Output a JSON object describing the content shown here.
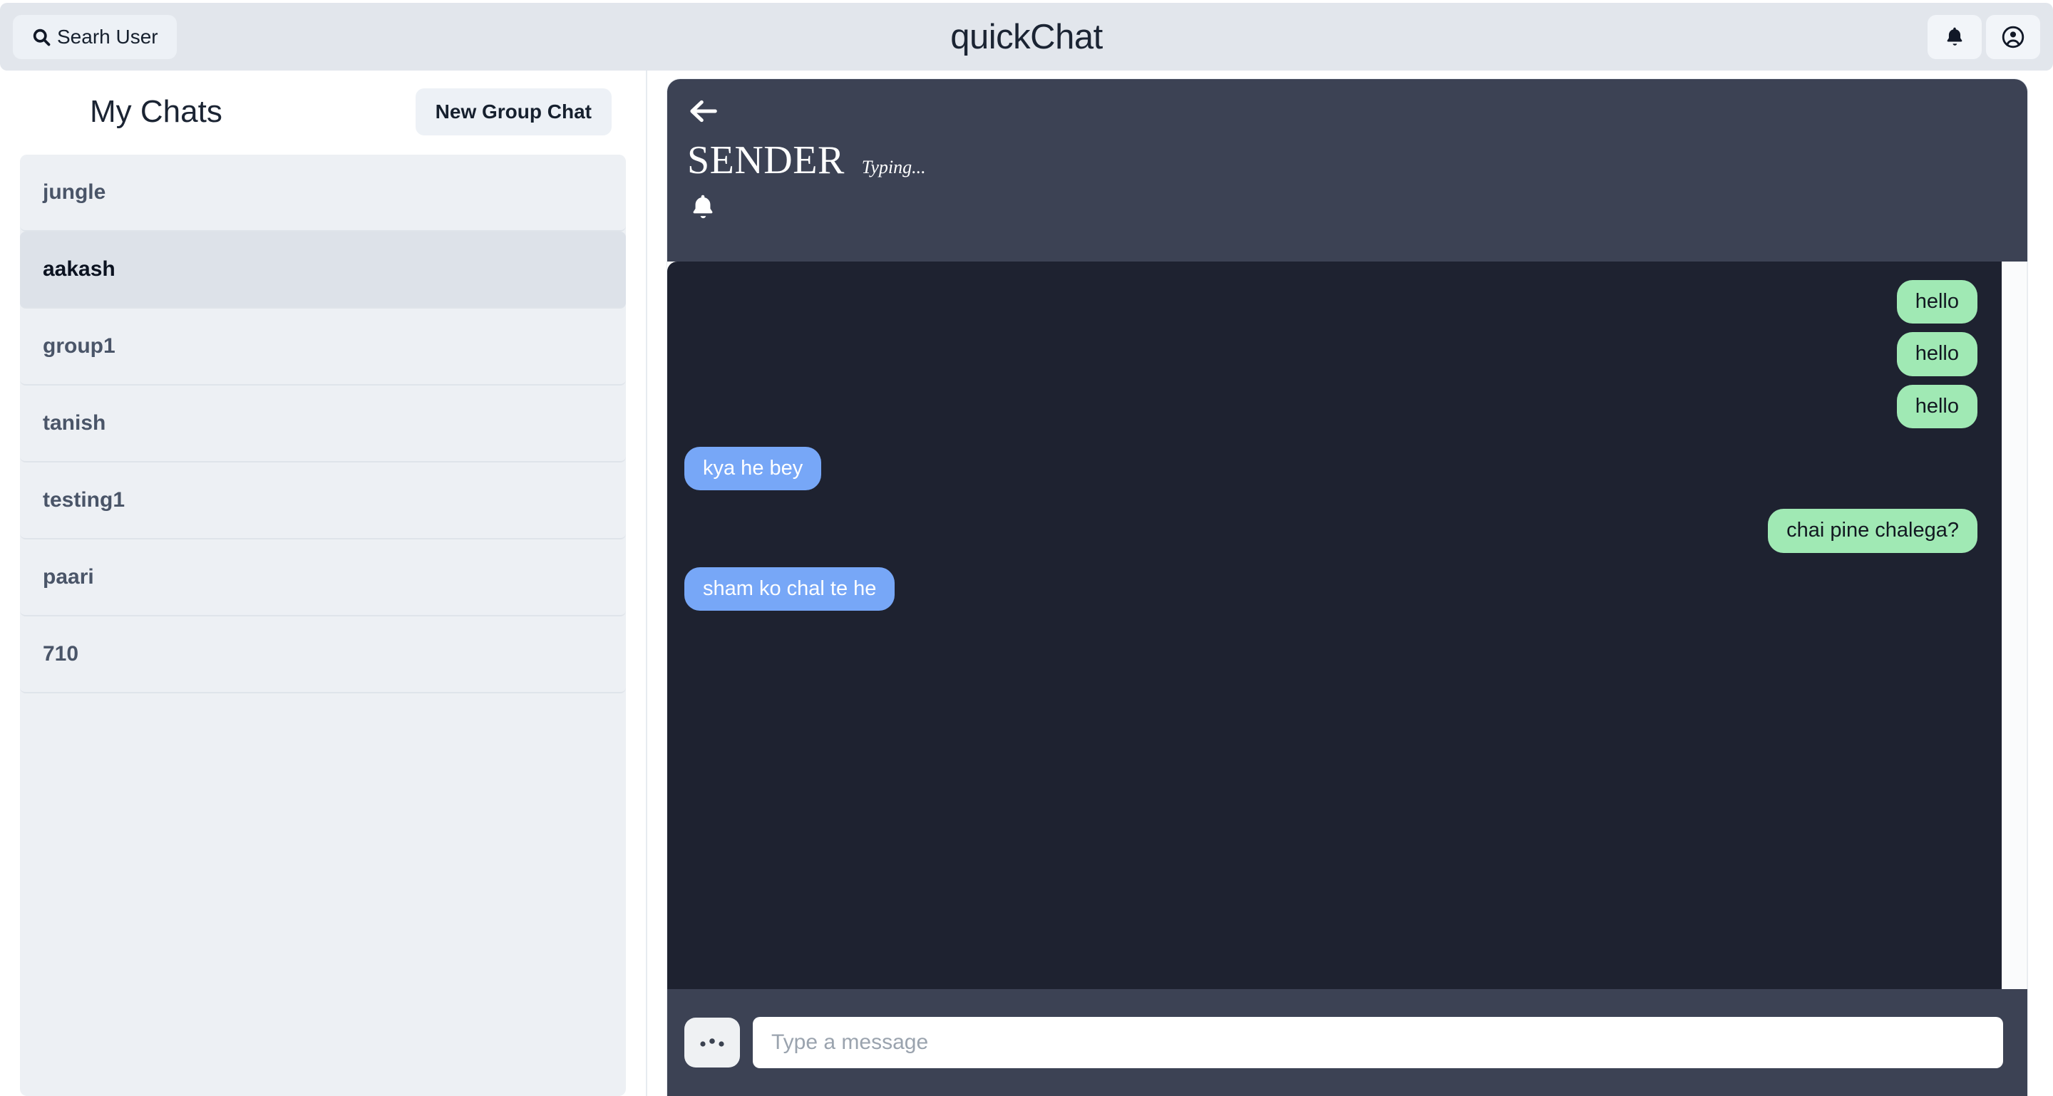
{
  "topbar": {
    "search_button_label": "Searh User",
    "search_icon": "search-icon",
    "app_title": "quickChat",
    "notifications_icon": "bell-icon",
    "profile_icon": "user-circle-icon"
  },
  "sidebar": {
    "title": "My Chats",
    "new_group_button_label": "New Group Chat",
    "chats": [
      {
        "name": "jungle",
        "selected": false
      },
      {
        "name": "aakash",
        "selected": true
      },
      {
        "name": "group1",
        "selected": false
      },
      {
        "name": "tanish",
        "selected": false
      },
      {
        "name": "testing1",
        "selected": false
      },
      {
        "name": "paari",
        "selected": false
      },
      {
        "name": "710",
        "selected": false
      }
    ]
  },
  "chat": {
    "back_icon": "back-arrow-icon",
    "sender_name": "SENDER",
    "typing_status": "Typing...",
    "bell_icon": "bell-icon",
    "messages": [
      {
        "text": "hello",
        "side": "right"
      },
      {
        "text": "hello",
        "side": "right"
      },
      {
        "text": "hello",
        "side": "right"
      },
      {
        "text": "kya he bey",
        "side": "left"
      },
      {
        "text": "chai pine chalega?",
        "side": "right"
      },
      {
        "text": "sham ko chal te he",
        "side": "left"
      }
    ],
    "composer": {
      "emoji_button_icon": "three-dots-icon",
      "input_value": "",
      "input_placeholder": "Type a message"
    }
  },
  "colors": {
    "topbar_bg": "#E2E6EC",
    "chat_header_bg": "#3C4254",
    "messages_bg": "#1E2230",
    "bubble_me": "#A0E9B4",
    "bubble_them": "#77A7F7",
    "sidebar_item_bg": "#EDF0F4",
    "sidebar_item_selected_bg": "#DDE2E9"
  }
}
